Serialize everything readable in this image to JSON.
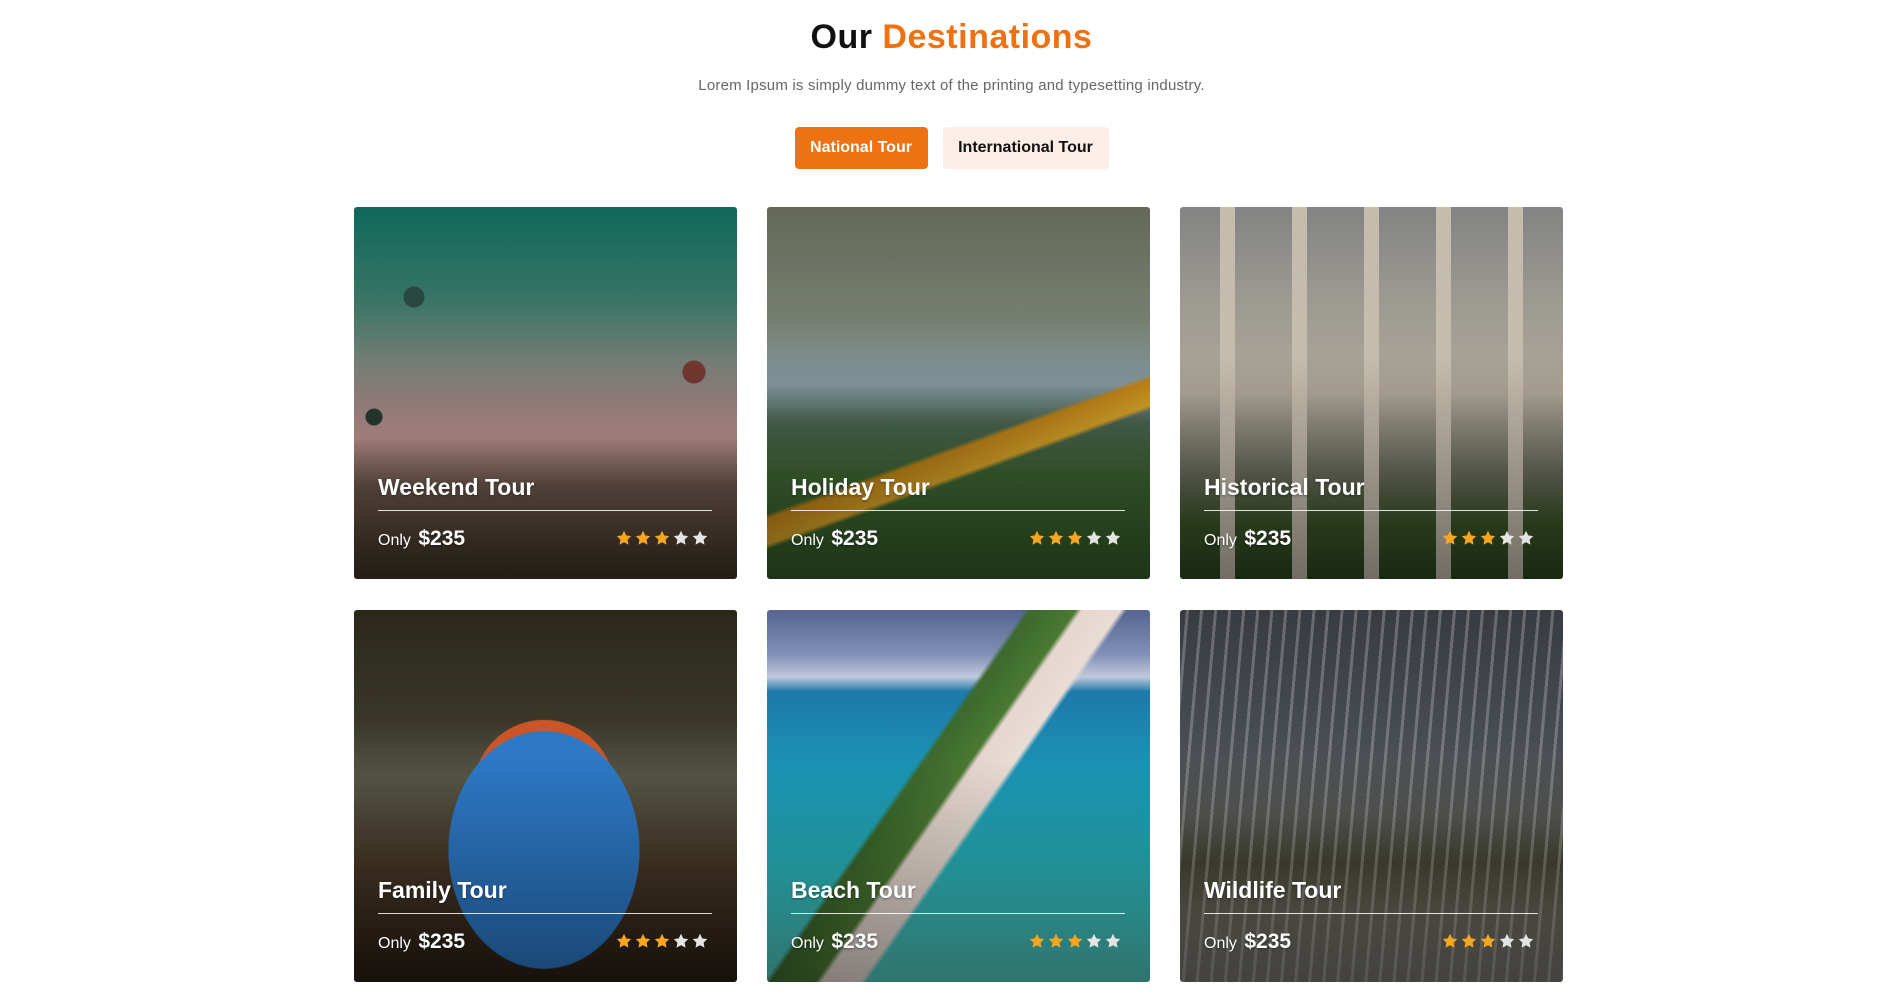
{
  "header": {
    "title_prefix": "Our",
    "title_accent": "Destinations",
    "subtitle": "Lorem Ipsum is simply dummy text of the printing and typesetting industry."
  },
  "tabs": [
    {
      "label": "National Tour",
      "active": true
    },
    {
      "label": "International Tour",
      "active": false
    }
  ],
  "colors": {
    "accent": "#ee7211",
    "inactive_tab_bg": "#fdeee8",
    "star_filled": "#f5a623",
    "star_empty": "#e4e4e4"
  },
  "tours": [
    {
      "title": "Weekend Tour",
      "price_prefix": "Only",
      "price": "$235",
      "rating": 3
    },
    {
      "title": "Holiday Tour",
      "price_prefix": "Only",
      "price": "$235",
      "rating": 3
    },
    {
      "title": "Historical Tour",
      "price_prefix": "Only",
      "price": "$235",
      "rating": 3
    },
    {
      "title": "Family Tour",
      "price_prefix": "Only",
      "price": "$235",
      "rating": 3
    },
    {
      "title": "Beach Tour",
      "price_prefix": "Only",
      "price": "$235",
      "rating": 3
    },
    {
      "title": "Wildlife Tour",
      "price_prefix": "Only",
      "price": "$235",
      "rating": 3
    }
  ],
  "rating_max": 5
}
